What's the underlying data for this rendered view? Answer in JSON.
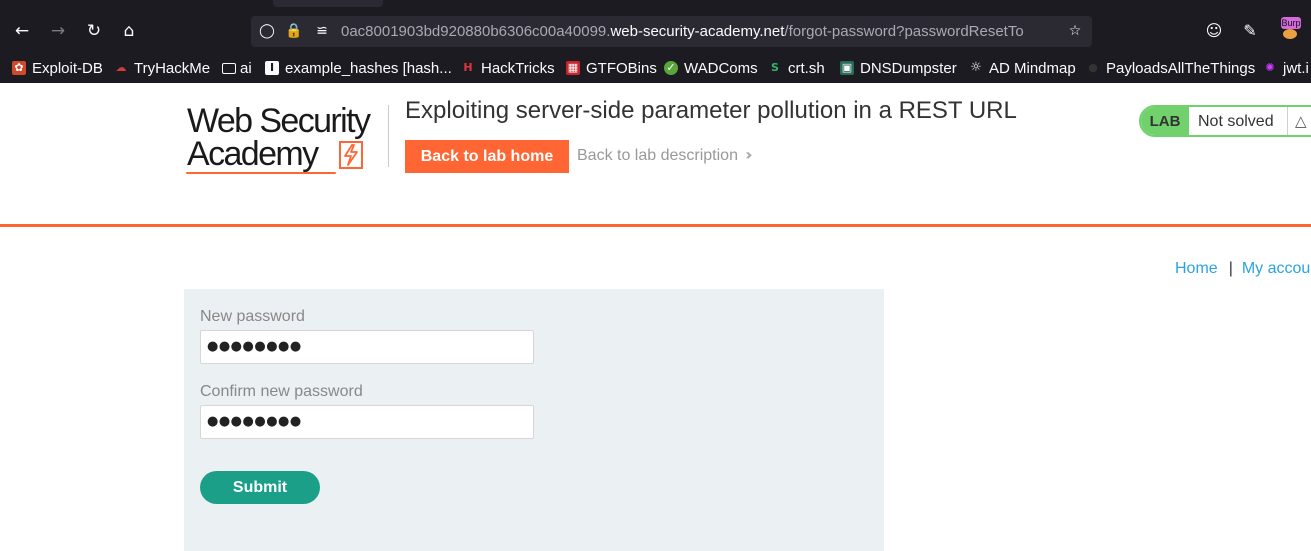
{
  "browser": {
    "url_prefix": "0ac8001903bd920880b6306c00a40099.",
    "url_host": "web-security-academy.net",
    "url_path": "/forgot-password?passwordResetTo",
    "extension_badge": "Burp"
  },
  "bookmarks": [
    {
      "label": "Exploit-DB"
    },
    {
      "label": "TryHackMe"
    },
    {
      "label": "ai"
    },
    {
      "label": "example_hashes [hash..."
    },
    {
      "label": "HackTricks"
    },
    {
      "label": "GTFOBins"
    },
    {
      "label": "WADComs"
    },
    {
      "label": "crt.sh"
    },
    {
      "label": "DNSDumpster"
    },
    {
      "label": "AD Mindmap"
    },
    {
      "label": "PayloadsAllTheThings"
    },
    {
      "label": "jwt.i"
    }
  ],
  "header": {
    "logo_line1": "Web Security",
    "logo_line2": "Academy",
    "lab_title": "Exploiting server-side parameter pollution in a REST URL",
    "back_home": "Back to lab home",
    "back_description": "Back to lab description",
    "lab_badge": "LAB",
    "lab_state": "Not solved"
  },
  "nav": {
    "home": "Home",
    "pipe": "|",
    "my_account": "My accou"
  },
  "form": {
    "new_password_label": "New password",
    "new_password_value": "●●●●●●●●",
    "confirm_password_label": "Confirm new password",
    "confirm_password_value": "●●●●●●●●",
    "submit": "Submit"
  },
  "colors": {
    "brand_orange": "#ff6633",
    "lab_green": "#70d16d",
    "submit_teal": "#1c9f89",
    "link_blue": "#2ba4dd",
    "panel_bg": "#ebf0f2"
  }
}
